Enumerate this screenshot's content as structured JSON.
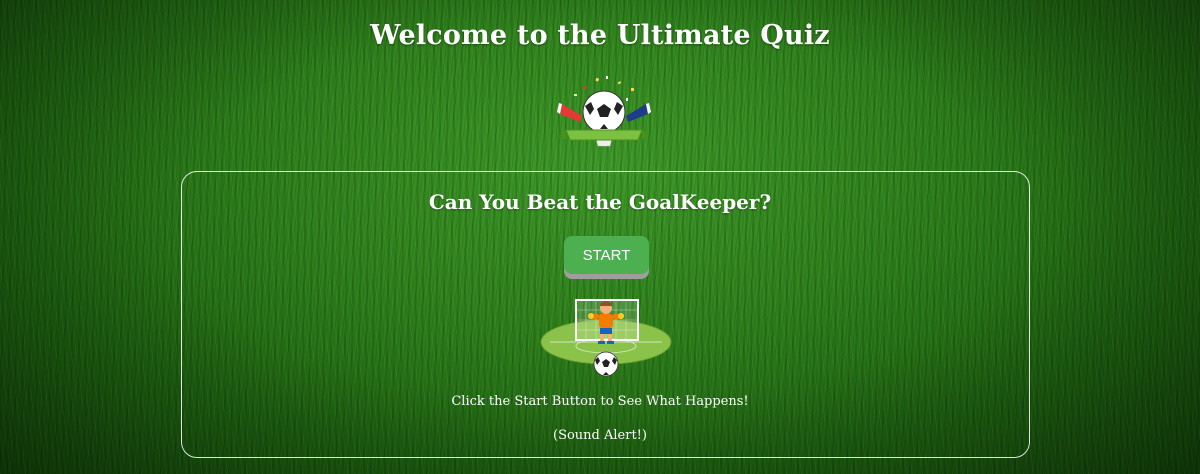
{
  "header": {
    "title": "Welcome to the Ultimate Quiz"
  },
  "logo": {
    "icon": "soccer-trophy-logo-icon"
  },
  "card": {
    "heading": "Can You Beat the GoalKeeper?",
    "start_label": "START",
    "illustration_icon": "goalkeeper-icon",
    "instruction": "Click the Start Button to See What Happens!",
    "sound_alert": "(Sound Alert!)"
  },
  "colors": {
    "button_green": "#4caf50",
    "text": "#ffffff",
    "field_green": "#2e7f1c"
  }
}
